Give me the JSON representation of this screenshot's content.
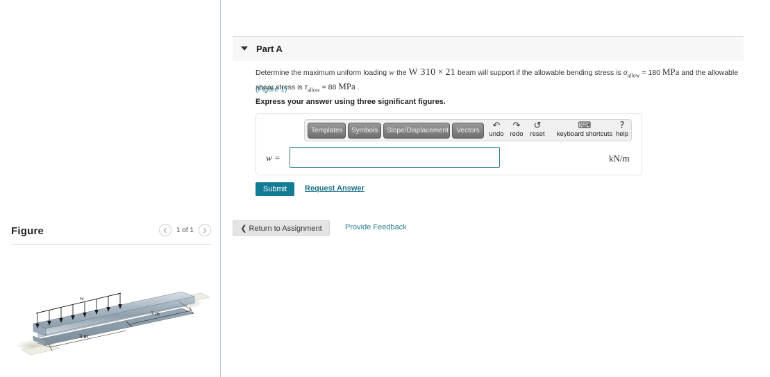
{
  "sidebar": {
    "figure_title": "Figure",
    "pager": {
      "prev_icon": "chevron-left-icon",
      "next_icon": "chevron-right-icon",
      "count_label": "1 of 1"
    },
    "figure": {
      "load_label": "w",
      "dimension_left": "3 m",
      "dimension_right": "3 m",
      "description": "Isometric wide-flange I-beam on two supports with uniform distributed load w over the left half; two 3 m span dimensions."
    }
  },
  "main": {
    "part": {
      "caret_icon": "caret-down-icon",
      "label": "Part A"
    },
    "problem": {
      "line1_a": "Determine the maximum uniform loading",
      "var_w": "w",
      "line1_b": "the",
      "beam_spec_a": "W 310",
      "beam_spec_times": "×",
      "beam_spec_b": "21",
      "line1_c": "beam will support if the allowable bending stress is",
      "sigma_symbol": "σ",
      "sigma_sub": "allow",
      "sigma_eq": "= 180",
      "sigma_unit": "MPa",
      "line1_d": "and the allowable",
      "line2_a": "shear stress is",
      "tau_symbol": "τ",
      "tau_sub": "allow",
      "tau_eq": "= 88",
      "tau_unit": "MPa",
      "line2_b": ".",
      "figure_link": "(Figure 1)",
      "express_note": "Express your answer using three significant figures."
    },
    "answer": {
      "toolbar_buttons": [
        {
          "label": "Templates"
        },
        {
          "label": "Symbols"
        },
        {
          "label": "Slope/Displacement"
        },
        {
          "label": "Vectors"
        }
      ],
      "toolbar_tools": [
        {
          "label": "undo",
          "icon": "undo-arrow-icon",
          "glyph": "↶"
        },
        {
          "label": "redo",
          "icon": "redo-arrow-icon",
          "glyph": "↷"
        },
        {
          "label": "reset",
          "icon": "reset-icon",
          "glyph": "↺"
        },
        {
          "label": "keyboard shortcuts",
          "icon": "keyboard-icon",
          "glyph": "⌨"
        },
        {
          "label": "help",
          "icon": "help-icon",
          "glyph": "?"
        }
      ],
      "variable_label": "w =",
      "input_value": "",
      "input_placeholder": "",
      "units": "kN/m"
    },
    "actions": {
      "submit_label": "Submit",
      "request_answer_label": "Request Answer",
      "return_icon": "chevron-left-icon",
      "return_label": "Return to Assignment",
      "provide_feedback_label": "Provide Feedback"
    }
  },
  "colors": {
    "accent_teal": "#147b94",
    "link_teal": "#2b7c93",
    "panel_gray": "#f7f7f7",
    "button_gray": "#e4e4e4",
    "divider": "#b8c7d1"
  }
}
